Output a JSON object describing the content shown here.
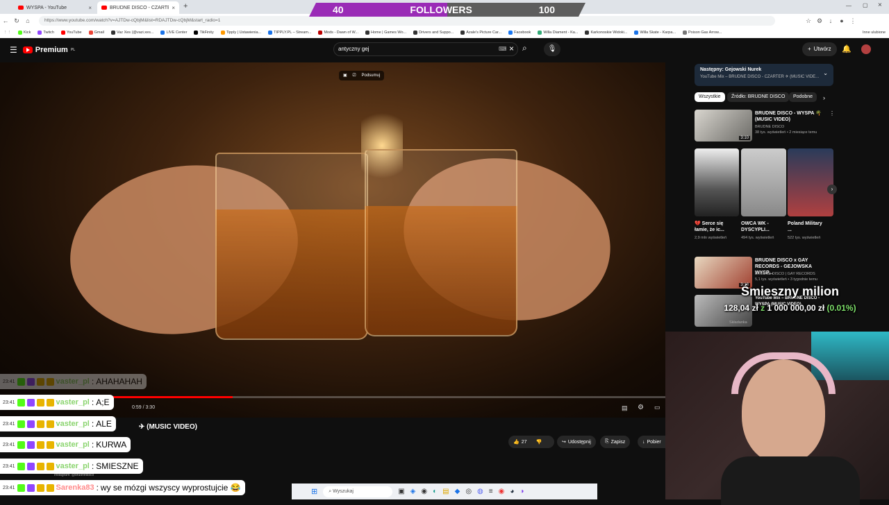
{
  "browser": {
    "tabs": [
      {
        "title": "WYSPA - YouTube",
        "close": "×"
      },
      {
        "title": "BRUDNE DISCO - CZARTER ✈ (M",
        "close": "×"
      }
    ],
    "new_tab": "+",
    "url": "https://www.youtube.com/watch?v=AJTDw-cQbjM&list=RDAJTDw-cQbjM&start_radio=1",
    "bookmarks": [
      "Kick",
      "Twitch",
      "YouTube",
      "Gmail",
      "Vaz Xes (@vazi.xes...",
      "LIVE Center",
      "TikFinity",
      "Tipply | Ustawienia...",
      "TIPPLY.PL – Stream...",
      "Mods - Dawn of W...",
      "Home | Games Wo...",
      "Drivers and Suppo...",
      "Azale's Picture Car...",
      "Facebook",
      "Willa Diament - Ka...",
      "Karkonoskie Widoki...",
      "Willa Skate - Karpa...",
      "Poison Gas Arrow..."
    ],
    "bookmarks_more": "Inne ulubione"
  },
  "followers": {
    "current": "40",
    "label": "FOLLOWERS",
    "goal": "100",
    "progress_fraction": 0.4
  },
  "youtube": {
    "logo": "Premium",
    "logo_region": "PL",
    "search_value": "antyczny gej",
    "create_label": "Utwórz",
    "video_overlay_summary": "Podsumuj",
    "time_display": "0:59 / 3:30",
    "progress_fraction": 0.35,
    "title_suffix": "(MUSIC VIDEO)",
    "likes": "27",
    "share": "Udostępnij",
    "save": "Zapisz",
    "download": "Pobier",
    "channel_social": "Instagram: @brudnedisco"
  },
  "sidebar": {
    "next_label": "Następny: Gejowski Nurek",
    "mix_label": "YouTube Mix – BRUDNE DISCO - CZARTER ✈ (MUSIC VIDE...",
    "chips": [
      "Wszystkie",
      "Źródło: BRUDNE DISCO",
      "Podobne"
    ],
    "videos": [
      {
        "title": "BRUDNE DISCO - WYSPA 🌴 (MUSIC VIDEO)",
        "channel": "BRUDNE DISCO",
        "meta": "38 tys. wyświetleń • 2 miesiące temu",
        "duration": "3:10"
      },
      {
        "title": "BRUDNE DISCO x GAY RECORDS - GEJOWSKA WYSP...",
        "channel": "BRUDNE DISCO | GAY RECORDS",
        "meta": "5,1 tys. wyświetleń • 3 tygodnie temu",
        "duration": "3:13"
      },
      {
        "title": "YouTube Mix – BRUDNE DISCO - WYSPA (MUSIC VIDEO)",
        "channel": "Składanka",
        "meta": "",
        "duration": ""
      }
    ],
    "shorts": [
      {
        "title": "💔 Serce się łamie, że ic...",
        "views": "2,9 mln wyświetleń"
      },
      {
        "title": "OWCA WK - DYSCYPLI...",
        "views": "494 tys. wyświetleń"
      },
      {
        "title": "Poland Military ...",
        "views": "522 tys. wyświetleń"
      }
    ]
  },
  "overlay": {
    "milion_title": "Śmieszny milion",
    "milion_current": "128,04 zł",
    "milion_sep": "z",
    "milion_goal": "1 000 000,00 zł",
    "milion_pct": "(0.01%)"
  },
  "chat": [
    {
      "time": "23:41",
      "user": "vaster_pl",
      "msg": "AHAHAHAH"
    },
    {
      "time": "23:41",
      "user": "vaster_pl",
      "msg": "A;E"
    },
    {
      "time": "23:41",
      "user": "vaster_pl",
      "msg": "ALE"
    },
    {
      "time": "23:41",
      "user": "vaster_pl",
      "msg": "KURWA"
    },
    {
      "time": "23:41",
      "user": "vaster_pl",
      "msg": "SMIESZNE"
    },
    {
      "time": "23:41",
      "user": "Sarenka83",
      "msg": "wy se mózgi wszyscy wyprostujcie 😂"
    }
  ],
  "taskbar": {
    "search_placeholder": "Wyszukaj"
  }
}
